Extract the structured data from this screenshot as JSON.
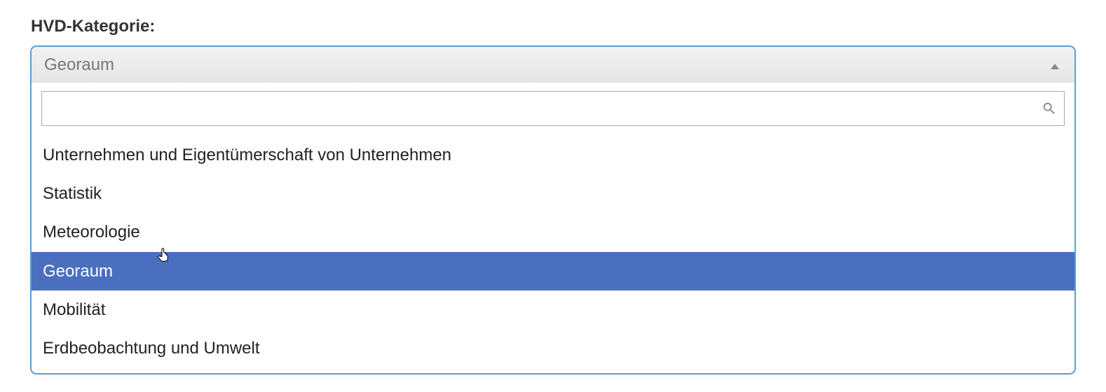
{
  "field_label": "HVD-Kategorie:",
  "dropdown": {
    "selected_label": "Georaum",
    "search_value": "",
    "options": [
      {
        "label": "Unternehmen und Eigentümerschaft von Unternehmen",
        "highlight": false
      },
      {
        "label": "Statistik",
        "highlight": false
      },
      {
        "label": "Meteorologie",
        "highlight": false
      },
      {
        "label": "Georaum",
        "highlight": true
      },
      {
        "label": "Mobilität",
        "highlight": false
      },
      {
        "label": "Erdbeobachtung und Umwelt",
        "highlight": false
      }
    ]
  }
}
